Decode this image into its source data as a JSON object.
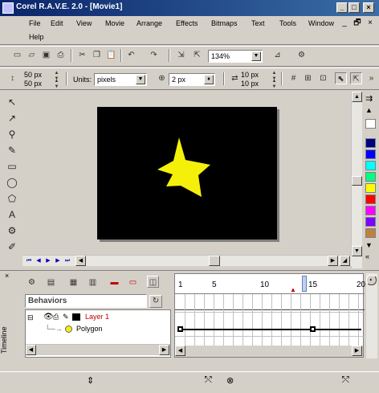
{
  "window": {
    "title": "Corel R.A.V.E. 2.0 - [Movie1]",
    "controls": [
      "_",
      "□",
      "×"
    ],
    "mdi_controls": [
      "_",
      "🗗",
      "×"
    ]
  },
  "menu": [
    "File",
    "Edit",
    "View",
    "Movie",
    "Arrange",
    "Effects",
    "Bitmaps",
    "Text",
    "Tools",
    "Window",
    "Help"
  ],
  "standard_toolbar": {
    "zoom": "134%"
  },
  "property_bar": {
    "width": "50 px",
    "height": "50 px",
    "units_label": "Units:",
    "units_value": "pixels",
    "nudge": "2 px",
    "dup_x": "10 px",
    "dup_y": "10 px"
  },
  "timeline": {
    "docker_label": "Timeline",
    "close": "×",
    "behaviors": "Behaviors",
    "frame_numbers": [
      "1",
      "5",
      "10",
      "15",
      "20"
    ],
    "layers": [
      {
        "name": "Layer 1",
        "color": "#c00000"
      },
      {
        "name": "Polygon",
        "color": "#000000"
      }
    ]
  },
  "colors": {
    "stage": "#000000",
    "star": "#f5f00a",
    "palette": [
      "#000080",
      "#0000ff",
      "#00ffff",
      "#00ff80",
      "#ffff00",
      "#ff0000",
      "#ff00ff",
      "#8000ff",
      "#c08040"
    ]
  }
}
